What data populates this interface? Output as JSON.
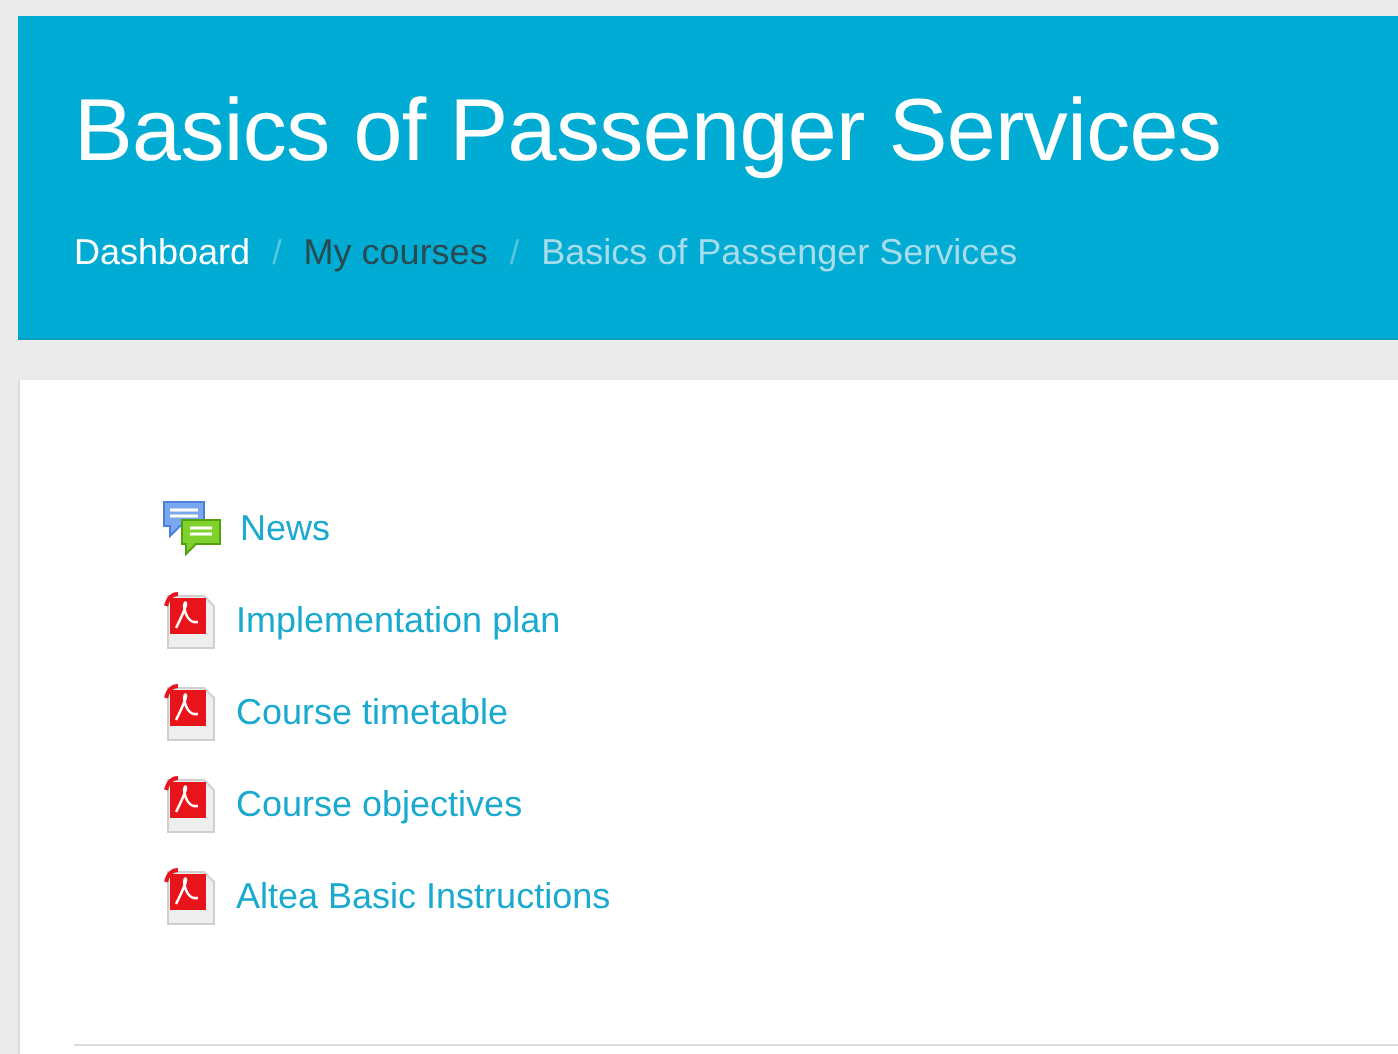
{
  "header": {
    "title": "Basics of Passenger Services"
  },
  "breadcrumb": [
    {
      "label": "Dashboard",
      "kind": "link"
    },
    {
      "label": "My courses",
      "kind": "hovered"
    },
    {
      "label": "Basics of Passenger Services",
      "kind": "current"
    }
  ],
  "breadcrumb_separator": "/",
  "activities": [
    {
      "label": "News",
      "kind": "forum"
    },
    {
      "label": "Implementation plan",
      "kind": "pdf"
    },
    {
      "label": "Course timetable",
      "kind": "pdf"
    },
    {
      "label": "Course objectives",
      "kind": "pdf"
    },
    {
      "label": "Altea Basic Instructions",
      "kind": "pdf"
    }
  ]
}
